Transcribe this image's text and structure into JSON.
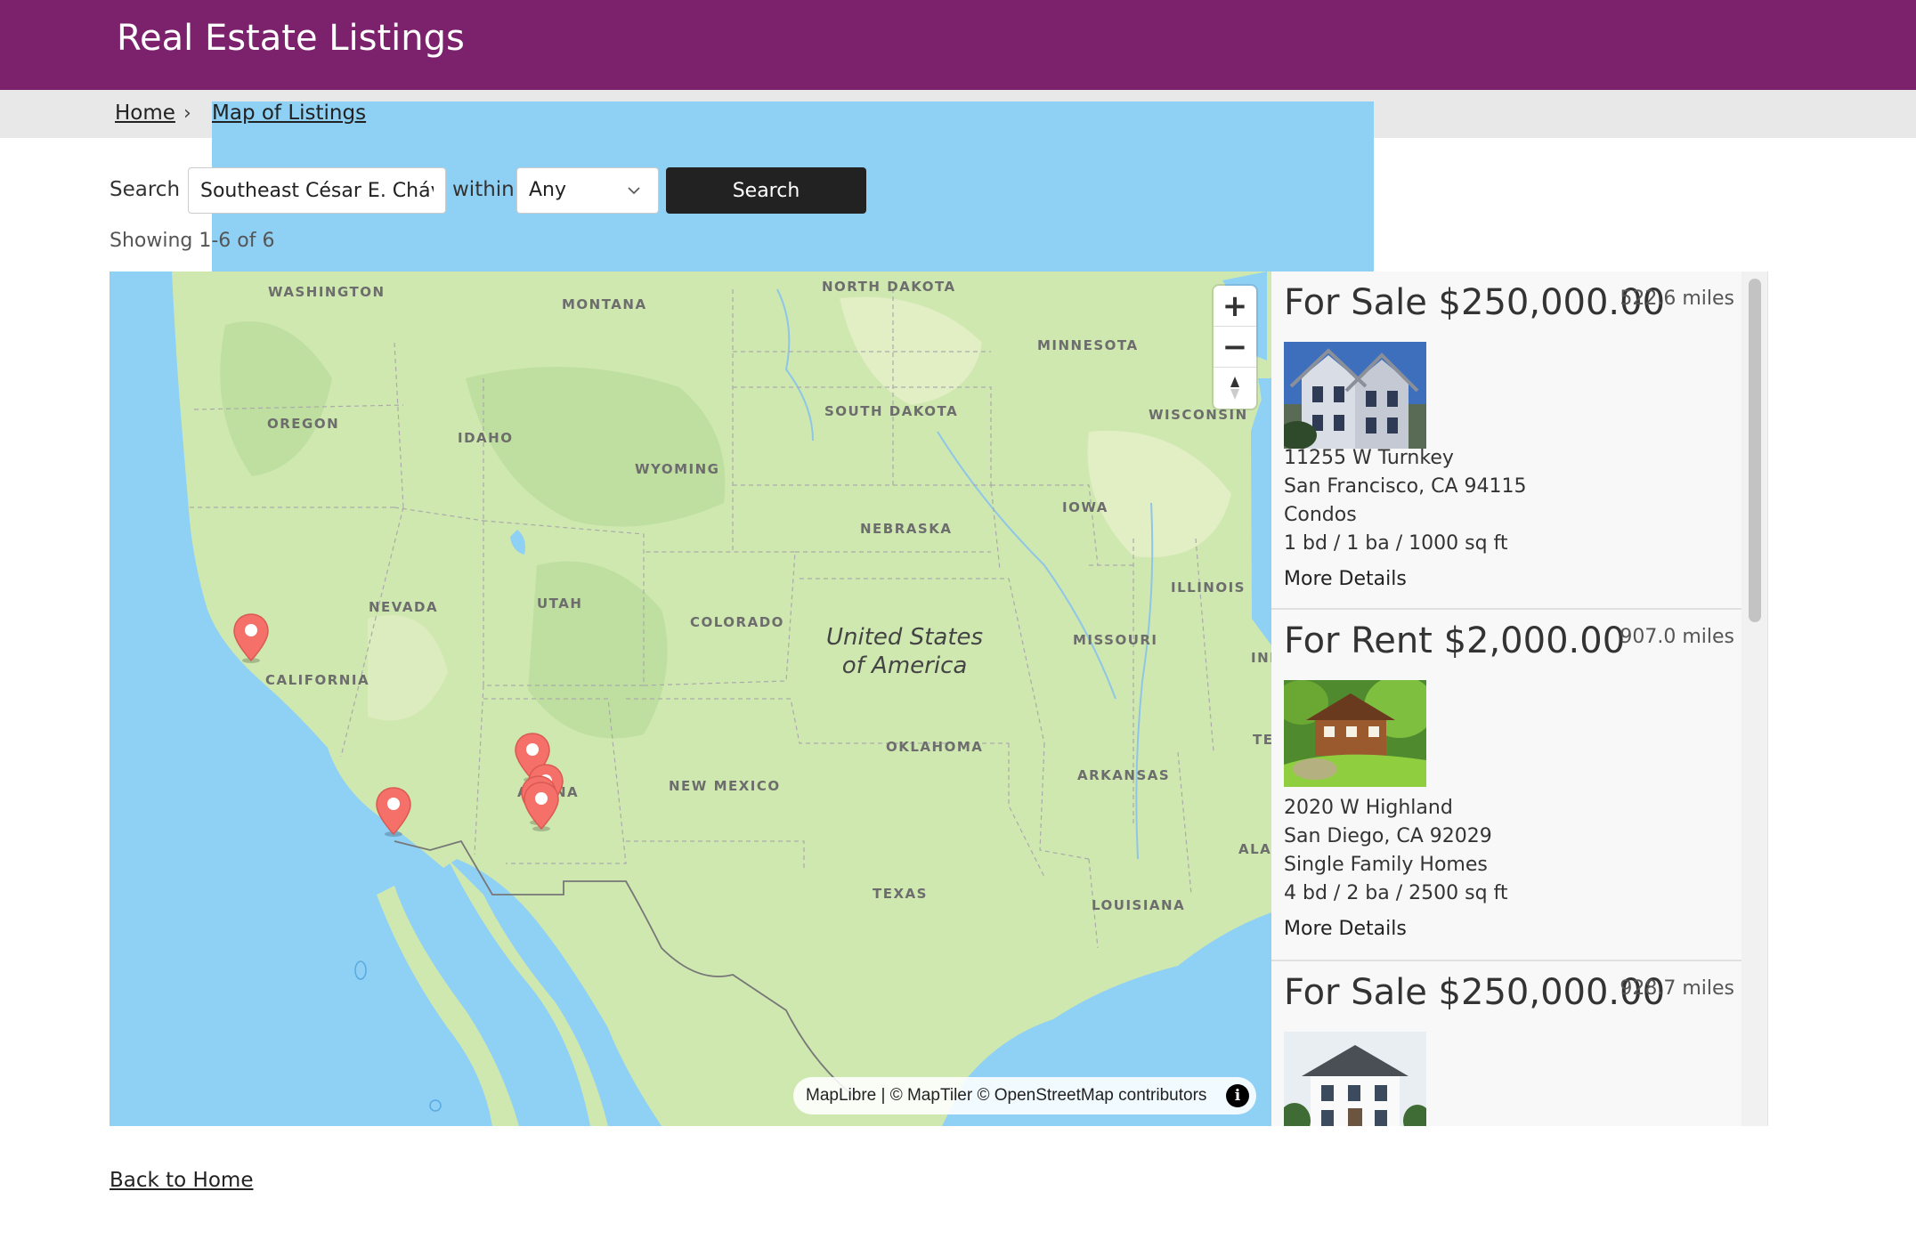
{
  "header": {
    "title": "Real Estate Listings"
  },
  "breadcrumb": {
    "home": "Home",
    "separator": "›",
    "current": "Map of Listings"
  },
  "search": {
    "label": "Search",
    "value": "Southeast César E. Chávez Avenue",
    "within_label": "within",
    "within_value": "Any",
    "button_label": "Search"
  },
  "results": {
    "showing": "Showing 1-6 of 6"
  },
  "map": {
    "country_label_1": "United States",
    "country_label_2": "of America",
    "states": {
      "washington": "WASHINGTON",
      "montana": "MONTANA",
      "north_dakota": "NORTH DAKOTA",
      "minnesota": "MINNESOTA",
      "oregon": "OREGON",
      "idaho": "IDAHO",
      "south_dakota": "SOUTH DAKOTA",
      "wisconsin": "WISCONSIN",
      "wyoming": "WYOMING",
      "iowa": "IOWA",
      "nebraska": "NEBRASKA",
      "illinois": "ILLINOIS",
      "nevada": "NEVADA",
      "utah": "UTAH",
      "colorado": "COLORADO",
      "missouri": "MISSOURI",
      "ind": "IND",
      "california": "CALIFORNIA",
      "oklahoma": "OKLAHOMA",
      "arkansas": "ARKANSAS",
      "te": "TE",
      "new_mexico": "NEW MEXICO",
      "arizona_a": "A",
      "arizona_na": "NA",
      "alab": "ALAE",
      "texas": "TEXAS",
      "louisiana": "LOUISIANA"
    },
    "zoom_in": "+",
    "zoom_out": "−",
    "attribution": "MapLibre | © MapTiler © OpenStreetMap contributors",
    "info_icon": "i",
    "pin_color": "#f47068",
    "pin_count": 6
  },
  "listings": [
    {
      "price": "For Sale $250,000.00",
      "distance": "522.6 miles",
      "street": "11255 W Turnkey",
      "city": "San Francisco, CA 94115",
      "type": "Condos",
      "specs": "1 bd / 1 ba / 1000 sq ft",
      "more": "More Details"
    },
    {
      "price": "For Rent $2,000.00",
      "distance": "907.0 miles",
      "street": "2020 W Highland",
      "city": "San Diego, CA 92029",
      "type": "Single Family Homes",
      "specs": "4 bd / 2 ba / 2500 sq ft",
      "more": "More Details"
    },
    {
      "price": "For Sale $250,000.00",
      "distance": "928.7 miles"
    }
  ],
  "footer": {
    "back_link": "Back to Home"
  },
  "colors": {
    "header_bg": "#7c216b",
    "search_button": "#222222",
    "map_water": "#8fd0f5",
    "map_land": "#cfe8b0"
  }
}
